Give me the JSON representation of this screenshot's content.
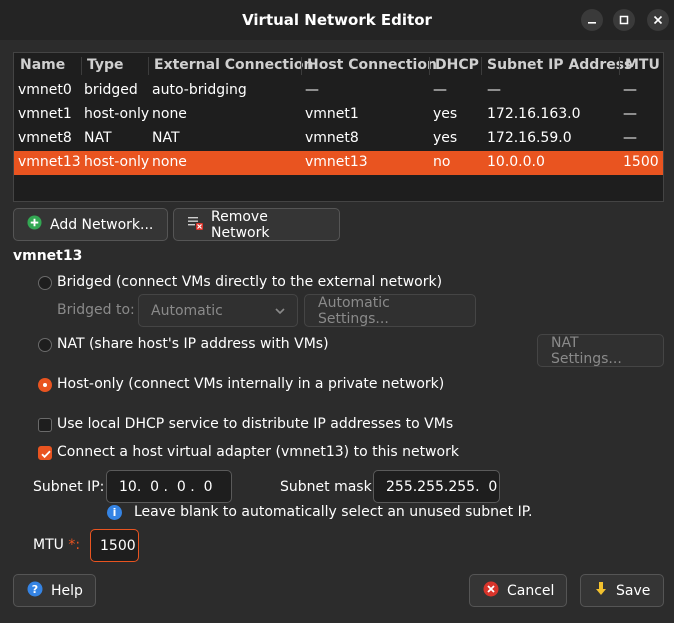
{
  "window": {
    "title": "Virtual Network Editor",
    "minimize_icon": "minimize-icon",
    "maximize_icon": "maximize-icon",
    "close_icon": "close-icon"
  },
  "table": {
    "columns": [
      "Name",
      "Type",
      "External Connection",
      "Host Connection",
      "DHCP",
      "Subnet IP Address",
      "MTU"
    ],
    "rows": [
      {
        "name": "vmnet0",
        "type": "bridged",
        "external": "auto-bridging",
        "host": "—",
        "dhcp": "—",
        "subnet": "—",
        "mtu": "—"
      },
      {
        "name": "vmnet1",
        "type": "host-only",
        "external": "none",
        "host": "vmnet1",
        "dhcp": "yes",
        "subnet": "172.16.163.0",
        "mtu": "—"
      },
      {
        "name": "vmnet8",
        "type": "NAT",
        "external": "NAT",
        "host": "vmnet8",
        "dhcp": "yes",
        "subnet": "172.16.59.0",
        "mtu": "—"
      },
      {
        "name": "vmnet13",
        "type": "host-only",
        "external": "none",
        "host": "vmnet13",
        "dhcp": "no",
        "subnet": "10.0.0.0",
        "mtu": "1500"
      }
    ],
    "selected_row": 3
  },
  "actions": {
    "add_network": "Add Network...",
    "remove_network": "Remove Network"
  },
  "settings": {
    "network_name": "vmnet13",
    "bridged_label": "Bridged (connect VMs directly to the external network)",
    "bridged_to_label": "Bridged to:",
    "bridged_to_value": "Automatic",
    "automatic_settings": "Automatic Settings...",
    "nat_label": "NAT (share host's IP address with VMs)",
    "nat_settings": "NAT Settings...",
    "hostonly_label": "Host-only (connect VMs internally in a private network)",
    "dhcp_label": "Use local DHCP service to distribute IP addresses to VMs",
    "adapter_label": "Connect a host virtual adapter (vmnet13) to this network",
    "subnet_ip_label": "Subnet IP:",
    "subnet_ip_value": "10.  0 .  0 .  0",
    "subnet_mask_label": "Subnet mask:",
    "subnet_mask_value": "255.255.255.  0",
    "hint": "Leave blank to automatically select an unused subnet IP.",
    "mtu_label": "MTU",
    "mtu_required": "*:",
    "mtu_value": "1500"
  },
  "footer": {
    "help": "Help",
    "cancel": "Cancel",
    "save": "Save"
  },
  "colors": {
    "accent": "#e95420",
    "background": "#2c2c2c",
    "info": "#3584e4"
  }
}
